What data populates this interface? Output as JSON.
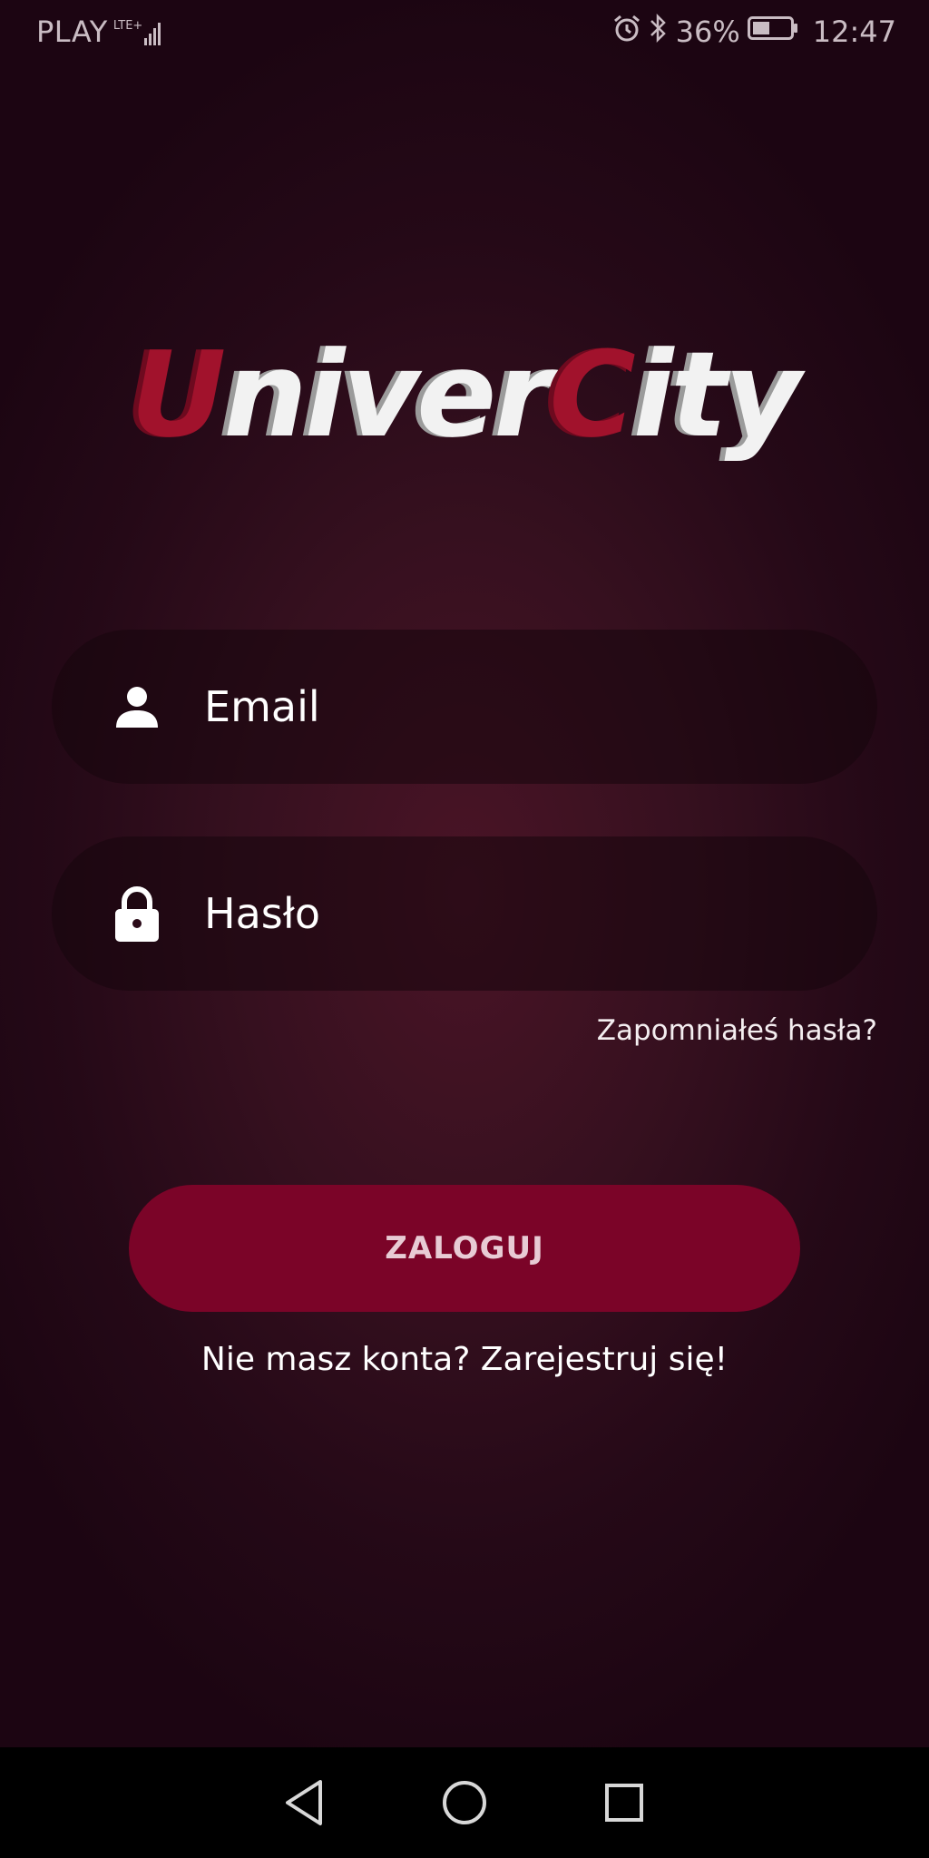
{
  "status_bar": {
    "carrier": "PLAY",
    "network": "LTE+",
    "battery_percent": "36%",
    "time": "12:47",
    "icons": [
      "signal-icon",
      "alarm-icon",
      "bluetooth-icon",
      "battery-icon"
    ]
  },
  "logo": {
    "part1_red": "U",
    "part1_white": "niver",
    "part2_red": "C",
    "part2_white": "ity"
  },
  "form": {
    "email_placeholder": "Email",
    "password_placeholder": "Hasło",
    "email_icon": "person-icon",
    "password_icon": "lock-icon",
    "forgot_password": "Zapomniałeś hasła?",
    "login_label": "ZALOGUJ",
    "register_prompt": "Nie masz konta? Zarejestruj się!"
  },
  "nav_bar": {
    "buttons": [
      "back-icon",
      "home-icon",
      "recents-icon"
    ]
  },
  "colors": {
    "background": "#2a0a18",
    "accent": "#7b0428",
    "logo_red": "#a1122c"
  }
}
